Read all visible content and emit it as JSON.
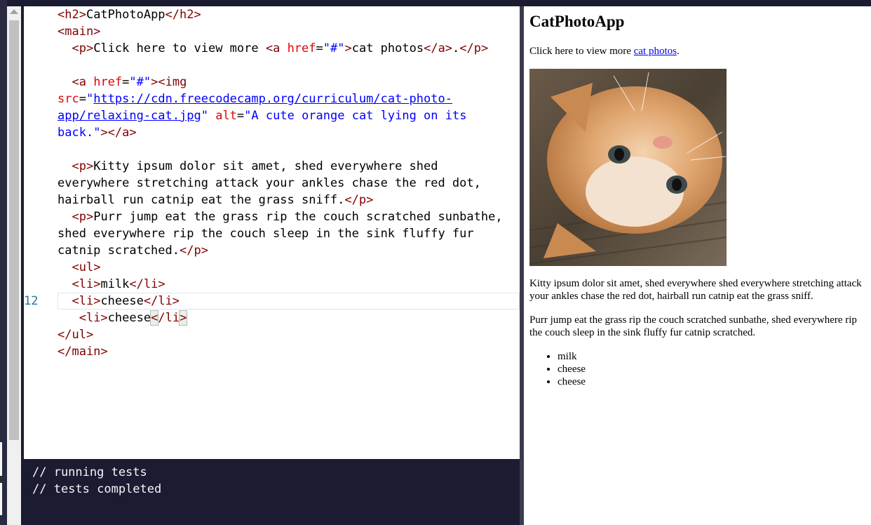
{
  "editor": {
    "active_line_number": "12",
    "lines": {
      "h2_text": "CatPhotoApp",
      "p1_text": "Click here to view more ",
      "p1_link_text": "cat photos",
      "p1_end": ".",
      "img_url": "https://cdn.freecodecamp.org/curriculum/cat-photo-app/relaxing-cat.jpg",
      "img_alt": "A cute orange cat lying on its back.",
      "kitty_text": "Kitty ipsum dolor sit amet, shed everywhere shed everywhere stretching attack your ankles chase the red dot, hairball run catnip eat the grass sniff.",
      "purr_text": "Purr jump eat the grass rip the couch scratched sunbathe, shed everywhere rip the couch sleep in the sink fluffy fur catnip scratched.",
      "li1": "milk",
      "li2": "cheese",
      "li3": "cheese"
    }
  },
  "console": {
    "line1": "// running tests",
    "line2": "// tests completed"
  },
  "preview": {
    "title": "CatPhotoApp",
    "p1_text": "Click here to view more ",
    "p1_link": "cat photos",
    "p1_end": ".",
    "img_alt": "A cute orange cat lying on its back.",
    "kitty_text": "Kitty ipsum dolor sit amet, shed everywhere shed everywhere stretching attack your ankles chase the red dot, hairball run catnip eat the grass sniff.",
    "purr_text": "Purr jump eat the grass rip the couch scratched sunbathe, shed everywhere rip the couch sleep in the sink fluffy fur catnip scratched.",
    "list": [
      "milk",
      "cheese",
      "cheese"
    ]
  },
  "colors": {
    "tag": "#800000",
    "attribute": "#e50000",
    "string": "#0000ff",
    "console_bg": "#1b1b32",
    "link": "#0000ee"
  }
}
